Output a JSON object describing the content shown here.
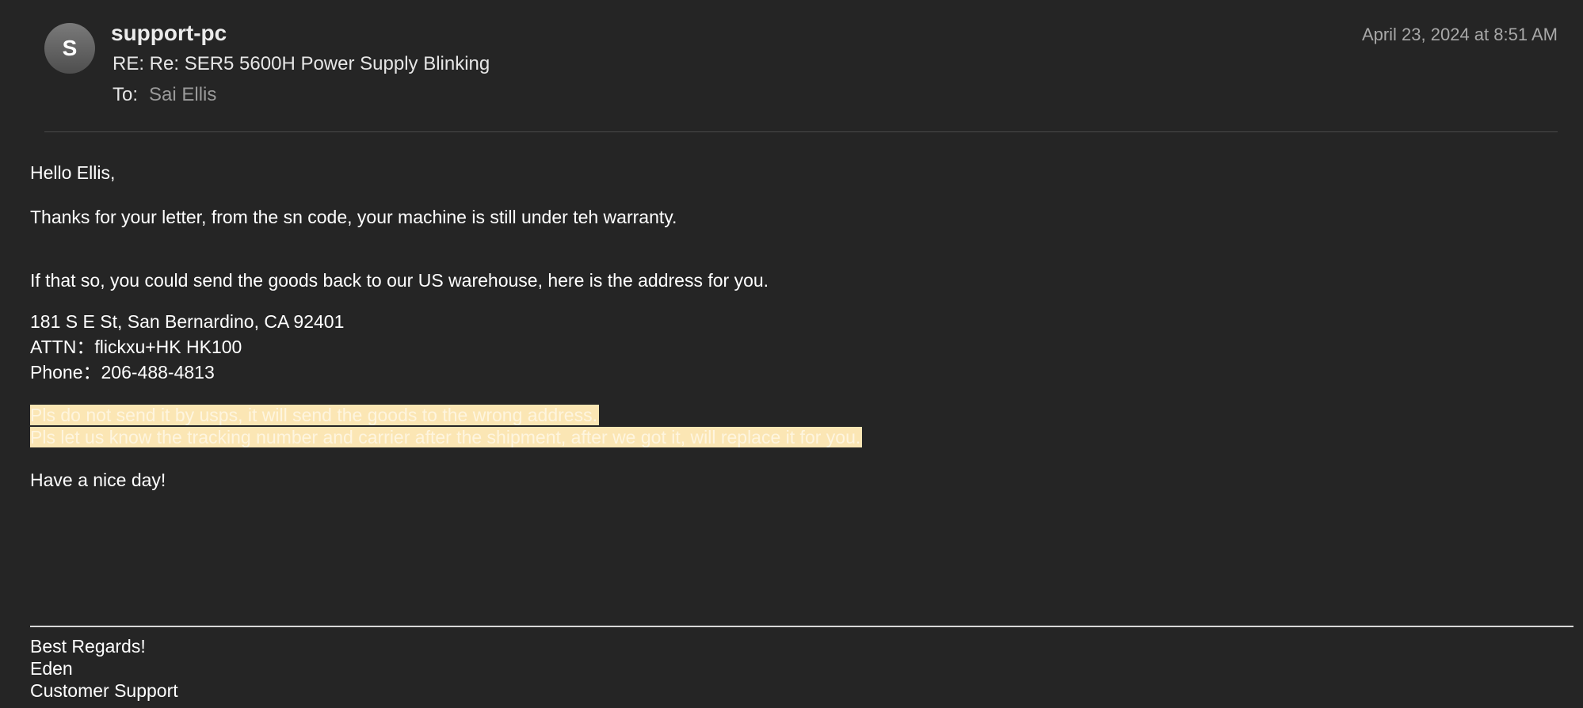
{
  "header": {
    "avatar_initial": "S",
    "sender": "support-pc",
    "subject": "RE: Re: SER5 5600H Power Supply Blinking",
    "to_label": "To:",
    "to_value": "Sai Ellis",
    "date": "April 23, 2024 at 8:51 AM"
  },
  "body": {
    "greeting": "Hello Ellis,",
    "para1": "Thanks for your letter, from the sn code, your machine is still under teh warranty.",
    "para2": "If that so, you could send the goods back to our US warehouse, here is the address for you.",
    "address": {
      "line1": "181 S E St, San Bernardino, CA 92401",
      "line2": "ATTN：flickxu+HK HK100",
      "line3": "Phone：206-488-4813"
    },
    "highlight": {
      "line1": "Pls do not send it by usps, it will send the goods to the wrong address.",
      "line2": "Pls let us know the tracking number and carrier after the shipment, after we got it, will replace it for you."
    },
    "closing": "Have a nice day!"
  },
  "signature": {
    "line1": "Best Regards!",
    "line2": "Eden",
    "line3": "Customer Support"
  },
  "colors": {
    "background": "#252525",
    "highlight": "#fbe6b4",
    "muted_text": "#9a9a9a"
  }
}
